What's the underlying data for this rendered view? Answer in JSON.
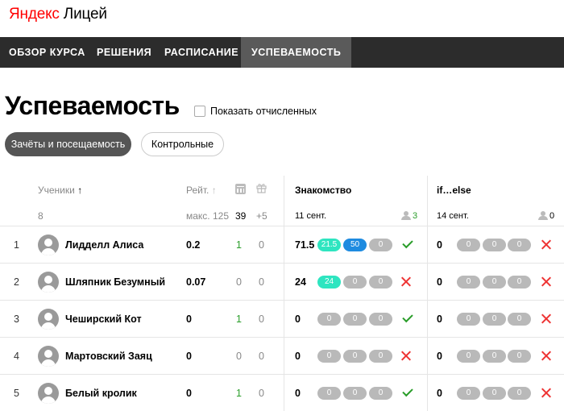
{
  "logo": {
    "brand": "Яндекс",
    "product": "Лицей"
  },
  "nav": {
    "overview": "ОБЗОР КУРСА",
    "solutions": "РЕШЕНИЯ",
    "schedule": "РАСПИСАНИЕ",
    "progress": "УСПЕВАЕМОСТЬ"
  },
  "page": {
    "title": "Успеваемость",
    "show_expelled": "Показать отчисленных",
    "tab_attendance": "Зачёты и посещаемость",
    "tab_tests": "Контрольные"
  },
  "table": {
    "students_header": "Ученики",
    "sort_arrow": "🡑",
    "students_count": "8",
    "rating_header": "Рейт.",
    "rating_max": "макс. 125",
    "lessons_count": "39",
    "bonus_count": "+5",
    "lessons": [
      {
        "title": "Знакомство",
        "date": "11 сент.",
        "attended": "3"
      },
      {
        "title": "if…else",
        "date": "14 сент.",
        "attended": "0"
      }
    ],
    "rows": [
      {
        "num": "1",
        "name": "Лидделл Алиса",
        "rating": "0.2",
        "c39": "1",
        "c5": "0",
        "l1_score": "71.5",
        "l1_pills": [
          "21.5",
          "50",
          "0"
        ],
        "l1_ok": true,
        "l2_score": "0",
        "l2_pills": [
          "0",
          "0",
          "0"
        ],
        "l2_ok": false
      },
      {
        "num": "2",
        "name": "Шляпник Безумный",
        "rating": "0.07",
        "c39": "0",
        "c5": "0",
        "l1_score": "24",
        "l1_pills": [
          "24",
          "0",
          "0"
        ],
        "l1_ok": false,
        "l2_score": "0",
        "l2_pills": [
          "0",
          "0",
          "0"
        ],
        "l2_ok": false
      },
      {
        "num": "3",
        "name": "Чеширский Кот",
        "rating": "0",
        "c39": "1",
        "c5": "0",
        "l1_score": "0",
        "l1_pills": [
          "0",
          "0",
          "0"
        ],
        "l1_ok": true,
        "l2_score": "0",
        "l2_pills": [
          "0",
          "0",
          "0"
        ],
        "l2_ok": false
      },
      {
        "num": "4",
        "name": "Мартовский Заяц",
        "rating": "0",
        "c39": "0",
        "c5": "0",
        "l1_score": "0",
        "l1_pills": [
          "0",
          "0",
          "0"
        ],
        "l1_ok": false,
        "l2_score": "0",
        "l2_pills": [
          "0",
          "0",
          "0"
        ],
        "l2_ok": false
      },
      {
        "num": "5",
        "name": "Белый кролик",
        "rating": "0",
        "c39": "1",
        "c5": "0",
        "l1_score": "0",
        "l1_pills": [
          "0",
          "0",
          "0"
        ],
        "l1_ok": true,
        "l2_score": "0",
        "l2_pills": [
          "0",
          "0",
          "0"
        ],
        "l2_ok": false
      }
    ]
  }
}
